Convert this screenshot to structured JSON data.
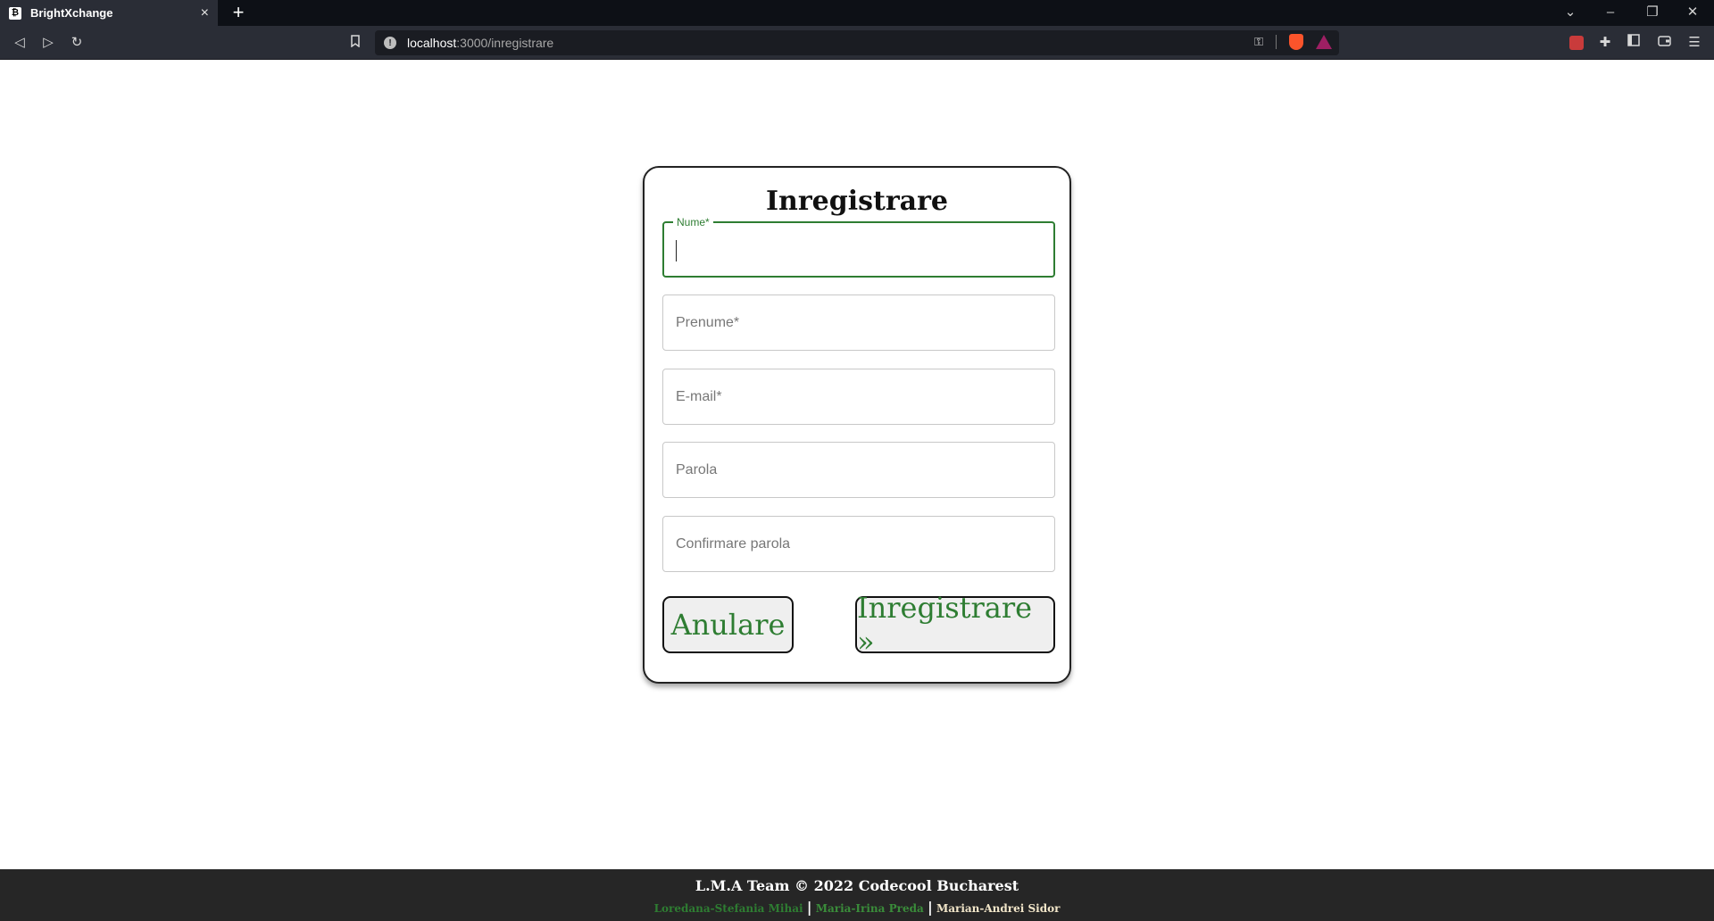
{
  "browser": {
    "tab_title": "BrightXchange",
    "tab_close": "×",
    "new_tab": "+",
    "url_host": "localhost",
    "url_path": ":3000/inregistrare",
    "window_controls": {
      "dropdown": "⌄",
      "minimize": "–",
      "restore": "❐",
      "close": "✕"
    },
    "nav": {
      "back": "◁",
      "forward": "▷",
      "reload": "↻"
    },
    "icons": [
      "bookmark-icon",
      "info-icon",
      "key-icon",
      "brave-shields-icon",
      "brave-rewards-icon",
      "extension-icon",
      "puzzle-icon",
      "sidebar-icon",
      "wallet-icon",
      "menu-icon"
    ]
  },
  "form": {
    "title": "Inregistrare",
    "fields": [
      {
        "label": "Nume*",
        "placeholder": "",
        "focused": true
      },
      {
        "label": "",
        "placeholder": "Prenume*"
      },
      {
        "label": "",
        "placeholder": "E-mail*"
      },
      {
        "label": "",
        "placeholder": "Parola"
      },
      {
        "label": "",
        "placeholder": "Confirmare parola"
      }
    ],
    "cancel_label": "Anulare",
    "submit_label": "Inregistrare »"
  },
  "footer": {
    "main": "L.M.A Team © 2022 Codecool Bucharest",
    "names": [
      "Loredana-Stefania Mihai",
      "Maria-Irina Preda",
      "Marian-Andrei Sidor"
    ],
    "separator": "|"
  },
  "colors": {
    "accent_green": "#2e7d32",
    "chrome_dark": "#0d1016",
    "toolbar": "#2a2d36",
    "footer_bg": "#262626"
  }
}
